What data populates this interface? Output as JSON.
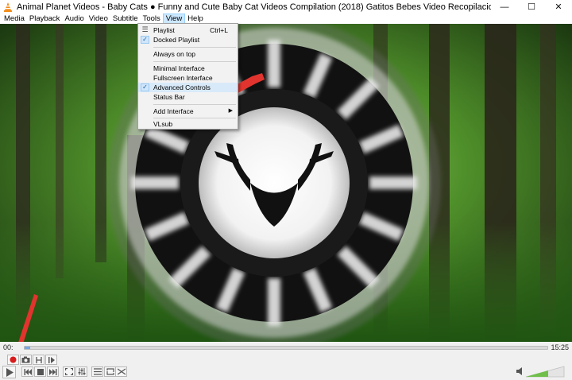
{
  "window": {
    "title": "Animal Planet Videos - Baby Cats ● Funny and Cute Baby Cat Videos Compilation (2018) Gatitos Bebes Video Recopilacion - VLC media player",
    "minimize": "—",
    "maximize": "☐",
    "close": "✕",
    "icon": "vlc-cone-icon"
  },
  "menubar": {
    "items": [
      "Media",
      "Playback",
      "Audio",
      "Video",
      "Subtitle",
      "Tools",
      "View",
      "Help"
    ],
    "active": "View"
  },
  "view_menu": {
    "playlist": "Playlist",
    "playlist_shortcut": "Ctrl+L",
    "docked_playlist": "Docked Playlist",
    "always_on_top": "Always on top",
    "minimal_interface": "Minimal Interface",
    "fullscreen_interface": "Fullscreen Interface",
    "advanced_controls": "Advanced Controls",
    "status_bar": "Status Bar",
    "add_interface": "Add Interface",
    "vlsub": "VLsub",
    "checked": [
      "Docked Playlist",
      "Advanced Controls"
    ]
  },
  "player": {
    "elapsed": "00:",
    "duration": "15:25",
    "progress_fraction": 0.01
  },
  "colors": {
    "annotation_arrow": "#e2342e",
    "record_button": "#d81b1b",
    "menu_highlight": "#cce8ff",
    "seek_fill": "#7aa7e0"
  }
}
